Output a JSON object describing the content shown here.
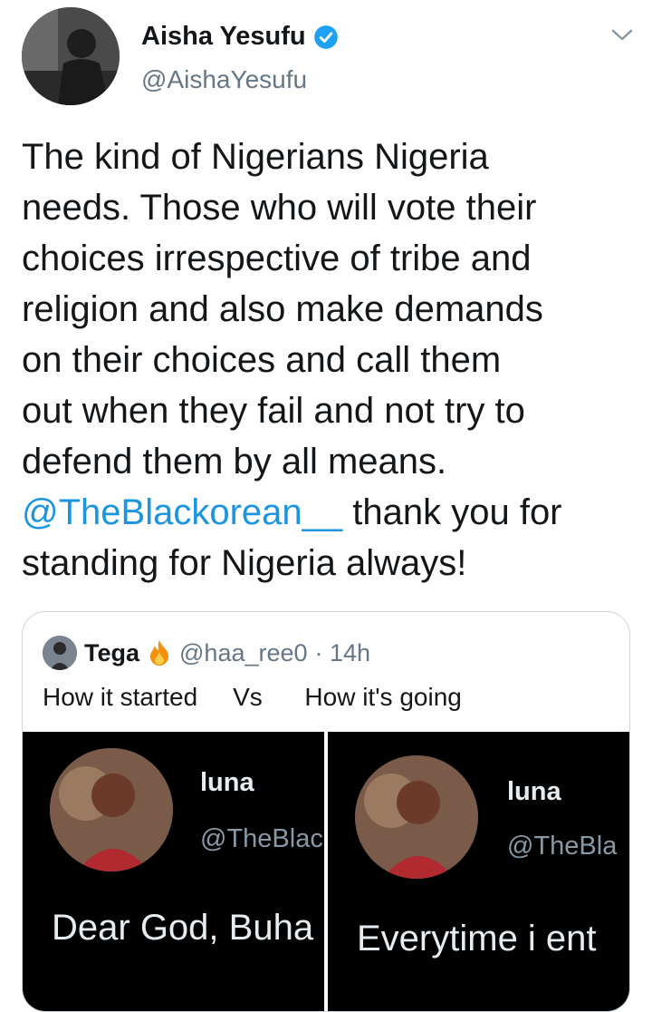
{
  "author": {
    "name": "Aisha Yesufu",
    "handle": "@AishaYesufu"
  },
  "tweet": {
    "text_lines": [
      "The kind of Nigerians Nigeria",
      "needs. Those who will vote their",
      "choices irrespective of tribe and",
      "religion and also make demands",
      "on their choices and call them",
      "out when they fail and not try to",
      "defend them by all means."
    ],
    "mention": "@TheBlackorean__",
    "after_mention": " thank you for",
    "last_line": "standing for Nigeria always!"
  },
  "quoted": {
    "name": "Tega",
    "handle": "@haa_ree0",
    "time": "· 14h",
    "text": "How it started     Vs      How it's going",
    "left": {
      "name": "luna",
      "handle": "@TheBlac",
      "text": "Dear God, Buha"
    },
    "right": {
      "name": "luna",
      "handle": "@TheBla",
      "text": "Everytime i ent"
    }
  },
  "colors": {
    "link": "#1b95e0",
    "secondary": "#657786",
    "verified": "#1da1f2"
  }
}
